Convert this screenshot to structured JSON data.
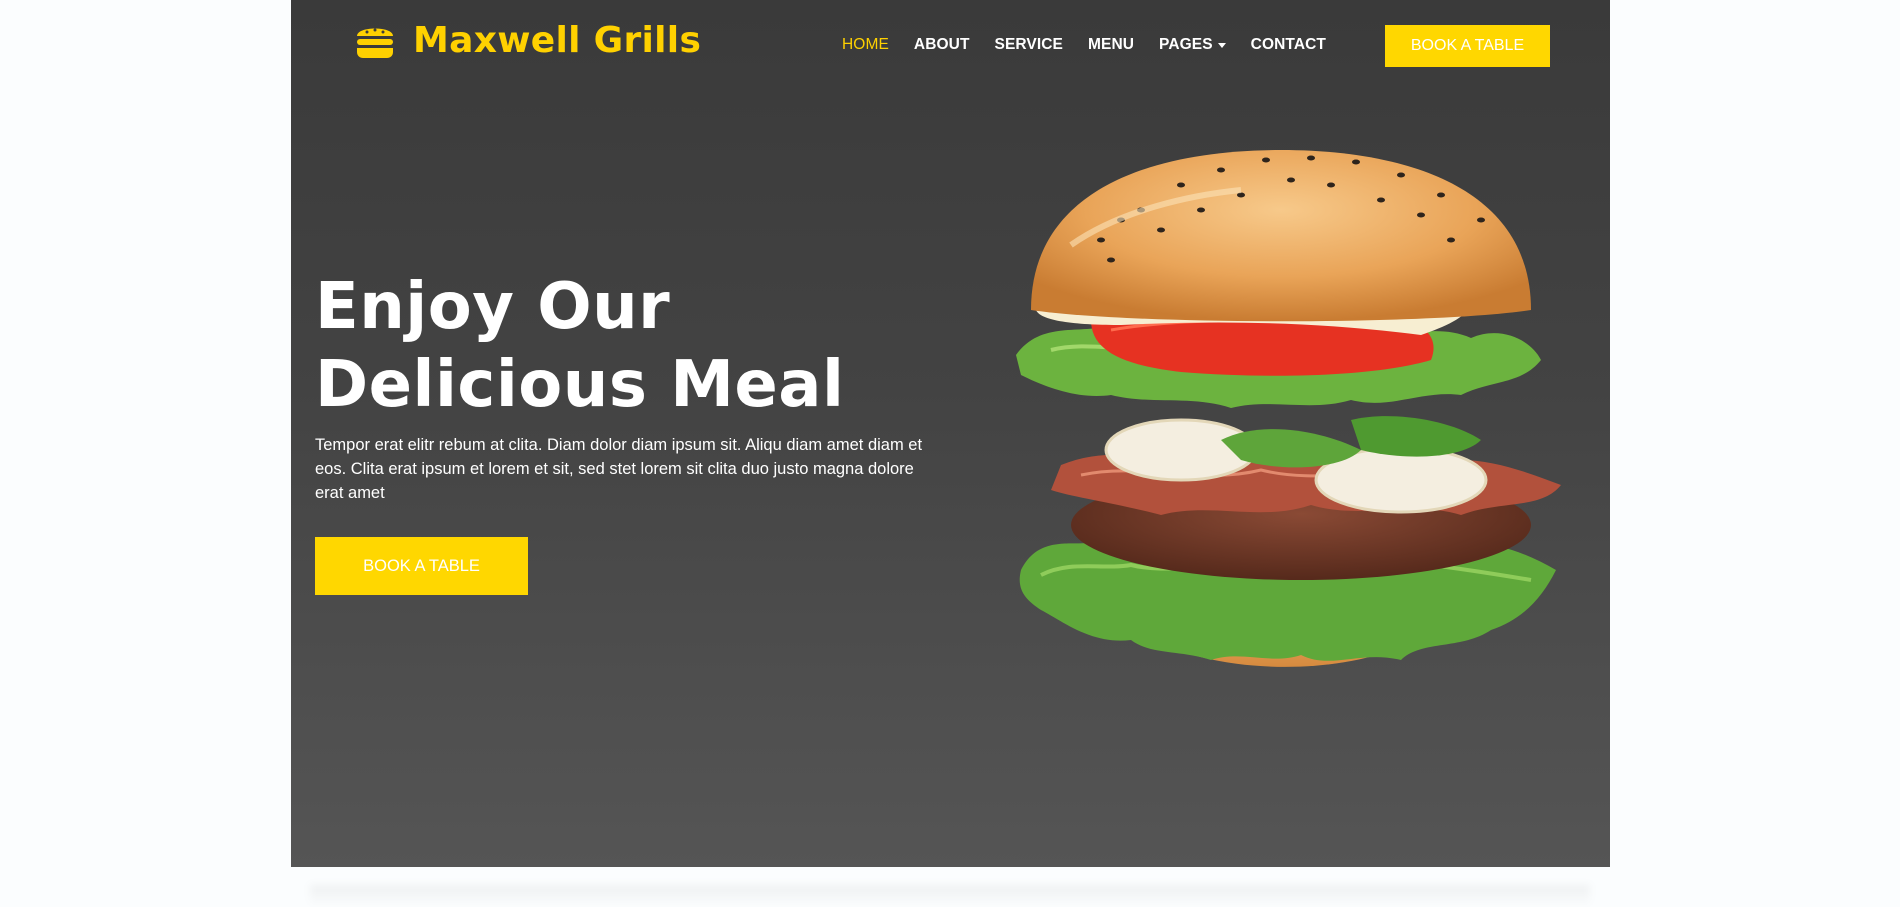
{
  "brand": {
    "name": "Maxwell Grills",
    "icon": "hamburger-icon",
    "color": "#FFD100"
  },
  "nav": {
    "items": [
      {
        "label": "HOME",
        "active": true
      },
      {
        "label": "ABOUT"
      },
      {
        "label": "SERVICE"
      },
      {
        "label": "MENU"
      },
      {
        "label": "PAGES",
        "dropdown": true
      },
      {
        "label": "CONTACT"
      }
    ],
    "cta_label": "BOOK A TABLE"
  },
  "hero": {
    "title_line1": "Enjoy Our",
    "title_line2": "Delicious Meal",
    "text": "Tempor erat elitr rebum at clita. Diam dolor diam ipsum sit. Aliqu diam amet diam et eos. Clita erat ipsum et lorem et sit, sed stet lorem sit clita duo justo magna dolore erat amet",
    "cta_label": "BOOK A TABLE",
    "image": "burger-image"
  },
  "colors": {
    "accent": "#FFD700",
    "hero_bg_top": "#3a3a3a",
    "hero_bg_bottom": "#555555",
    "page_bg": "#fbfdfe"
  }
}
